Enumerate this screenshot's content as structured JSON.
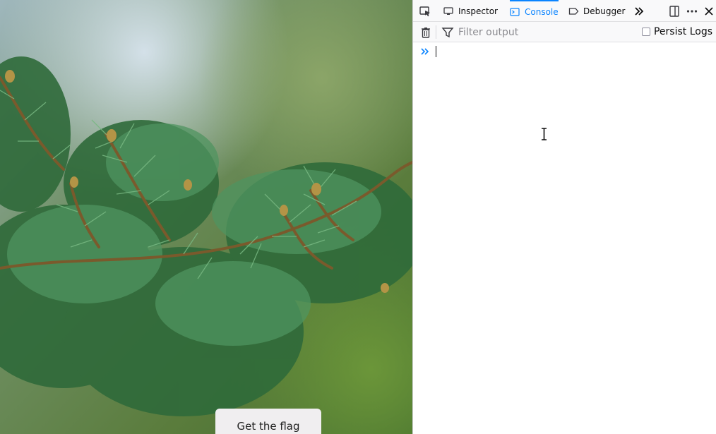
{
  "page": {
    "button_label": "Get the flag"
  },
  "devtools": {
    "toolbar": {
      "tabs": [
        {
          "label": "Inspector",
          "icon": "inspector-icon",
          "selected": false
        },
        {
          "label": "Console",
          "icon": "console-icon",
          "selected": true
        },
        {
          "label": "Debugger",
          "icon": "debugger-icon",
          "selected": false
        }
      ],
      "left_icon": "element-picker-icon",
      "right_icons": [
        "more-tabs-icon",
        "dock-side-icon",
        "menu-dots-icon",
        "close-icon"
      ]
    },
    "filterbar": {
      "clear_icon": "trash-icon",
      "filter_icon": "filter-icon",
      "filter_placeholder": "Filter output",
      "persist_label": "Persist Logs",
      "persist_checked": false
    },
    "console": {
      "input_value": "",
      "prompt_icon": "chevron-double-right-icon"
    },
    "colors": {
      "accent": "#0a84ff",
      "toolbar_bg": "#f9f9fa"
    }
  }
}
